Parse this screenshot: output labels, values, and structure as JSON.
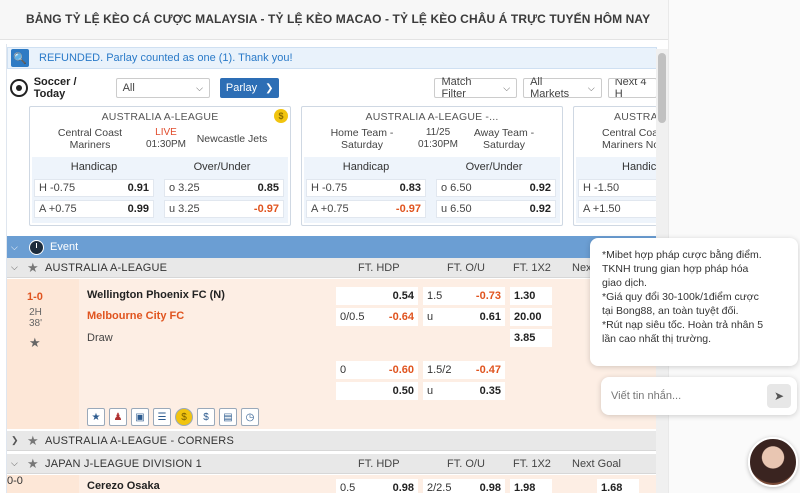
{
  "page": {
    "title": "BẢNG TỶ LỆ KÈO CÁ CƯỢC MALAYSIA - TỶ LỆ KÈO MACAO - TỶ LỆ KÈO CHÂU Á TRỰC TUYẾN HÔM NAY"
  },
  "notice": {
    "text": "REFUNDED. Parlay counted as one (1). Thank you!"
  },
  "toolbar": {
    "sport": "Soccer / Today",
    "all_label": "All",
    "parlay_label": "Parlay",
    "match_filter": "Match Filter",
    "all_markets": "All Markets",
    "next": "Next 4 H"
  },
  "cards": [
    {
      "league": "AUSTRALIA A-LEAGUE",
      "home": "Central Coast Mariners",
      "status": "LIVE",
      "time": "01:30PM",
      "away": "Newcastle Jets",
      "handicap_label": "Handicap",
      "ou_label": "Over/Under",
      "h_line": "H -0.75",
      "h_odds": "0.91",
      "a_line": "A +0.75",
      "a_odds": "0.99",
      "o_line": "o 3.25",
      "o_odds": "0.85",
      "u_line": "u 3.25",
      "u_odds": "-0.97"
    },
    {
      "league": "AUSTRALIA A-LEAGUE -...",
      "home": "Home Team - Saturday",
      "status": "11/25",
      "time": "01:30PM",
      "away": "Away Team - Saturday",
      "handicap_label": "Handicap",
      "ou_label": "Over/Under",
      "h_line": "H -0.75",
      "h_odds": "0.83",
      "a_line": "A +0.75",
      "a_odds": "-0.97",
      "o_line": "o 6.50",
      "o_odds": "0.92",
      "u_line": "u 6.50",
      "u_odds": "0.92"
    },
    {
      "league": "AUSTRALIA",
      "home": "Central Coa Mariners No",
      "handicap_label": "Handica",
      "h_line": "H -1.50",
      "a_line": "A +1.50"
    }
  ],
  "event_bar": {
    "label": "Event"
  },
  "league1": {
    "name": "AUSTRALIA A-LEAGUE",
    "ft_hdp": "FT. HDP",
    "ft_ou": "FT. O/U",
    "ft_1x2": "FT. 1X2",
    "next": "Next"
  },
  "match1": {
    "score": "1-0",
    "half": "2H",
    "minute": "38'",
    "home": "Wellington Phoenix FC (N)",
    "away": "Melbourne City FC",
    "draw": "Draw",
    "hdp1_h_odds": "0.54",
    "hdp1_line": "0/0.5",
    "hdp1_a_odds": "-0.64",
    "ou1_line": "1.5",
    "ou1_o_odds": "-0.73",
    "ou1_u": "u",
    "ou1_u_odds": "0.61",
    "x1": "1.30",
    "x2": "20.00",
    "x3": "3.85",
    "hdp2_line": "0",
    "hdp2_h_odds": "-0.60",
    "hdp2_a_odds": "0.50",
    "ou2_line": "1.5/2",
    "ou2_o_odds": "-0.47",
    "ou2_u": "u",
    "ou2_u_odds": "0.35"
  },
  "league2": {
    "name": "AUSTRALIA A-LEAGUE - CORNERS"
  },
  "league3": {
    "name": "JAPAN J-LEAGUE DIVISION 1",
    "ft_hdp": "FT. HDP",
    "ft_ou": "FT. O/U",
    "ft_1x2": "FT. 1X2",
    "next": "Next Goal"
  },
  "match2": {
    "score": "0-0",
    "home": "Cerezo Osaka",
    "hdp": "0.5",
    "hdp_odds": "0.98",
    "ou": "2/2.5",
    "ou_odds": "0.98",
    "x1": "1.98",
    "ng": "1.68"
  },
  "chat": {
    "message": "*Mibet hợp pháp cược bằng điểm. TKNH trung gian hợp pháp hóa giao dịch. *Giá quy đổi 30-100k/1điểm cược tại Bong88, an toàn tuyệt đối. *Rút nạp siêu tốc. Hoàn trả nhân 5 lần cao nhất thị trường.",
    "line1": "*Mibet hợp pháp cược bằng điểm.",
    "line2": "TKNH trung gian hợp pháp hóa",
    "line3": "giao dịch.",
    "line4": "*Giá quy đổi 30-100k/1điểm cược",
    "line5": "tại Bong88, an toàn tuyệt đối.",
    "line6": "*Rút nạp siêu tốc. Hoàn trả nhân 5",
    "line7": "lần cao nhất thị trường.",
    "placeholder": "Viết tin nhắn..."
  },
  "colors": {
    "accent": "#2d6eb5",
    "negative": "#e0541f",
    "event_bar": "#6b9ed3",
    "live_row": "#fdeee4"
  },
  "icons": [
    "info-icon",
    "soccer-ball-icon",
    "coin-icon",
    "clock-icon",
    "star-icon",
    "send-icon",
    "chevron-down-icon",
    "chevron-right-icon"
  ]
}
